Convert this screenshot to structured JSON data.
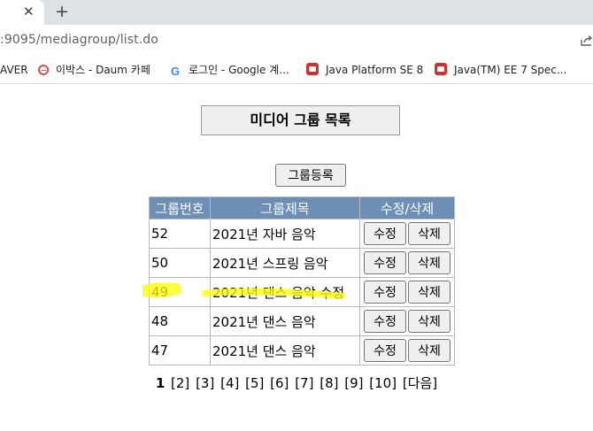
{
  "browser": {
    "tab_close_glyph": "✕",
    "newtab_glyph": "+",
    "url": ":9095/mediagroup/list.do",
    "bookmarks": [
      {
        "label": "AVER",
        "icon": "none"
      },
      {
        "label": "이박스 - Daum 카페",
        "icon": "daum-icon"
      },
      {
        "label": "로그인 - Google 계...",
        "icon": "google-icon"
      },
      {
        "label": "Java Platform SE 8",
        "icon": "java-icon"
      },
      {
        "label": "Java(TM) EE 7 Spec...",
        "icon": "java-icon"
      }
    ]
  },
  "page": {
    "title": "미디어 그룹 목록",
    "register_button": "그룹등록",
    "table": {
      "headers": [
        "그룹번호",
        "그룹제목",
        "수정/삭제"
      ],
      "rows": [
        {
          "no": "52",
          "title": "2021년 자바 음악",
          "edit": "수정",
          "delete": "삭제"
        },
        {
          "no": "50",
          "title": "2021년 스프링 음악",
          "edit": "수정",
          "delete": "삭제"
        },
        {
          "no": "49",
          "title": "2021년 댄스 음악 수정",
          "edit": "수정",
          "delete": "삭제"
        },
        {
          "no": "48",
          "title": "2021년 댄스 음악",
          "edit": "수정",
          "delete": "삭제"
        },
        {
          "no": "47",
          "title": "2021년 댄스 음악",
          "edit": "수정",
          "delete": "삭제"
        }
      ]
    },
    "pagination": {
      "current": "1",
      "pages": [
        "[2]",
        "[3]",
        "[4]",
        "[5]",
        "[6]",
        "[7]",
        "[8]",
        "[9]",
        "[10]"
      ],
      "next": "[다음]"
    },
    "highlight_color": "#ffff00",
    "header_color": "#6e8fb5"
  }
}
